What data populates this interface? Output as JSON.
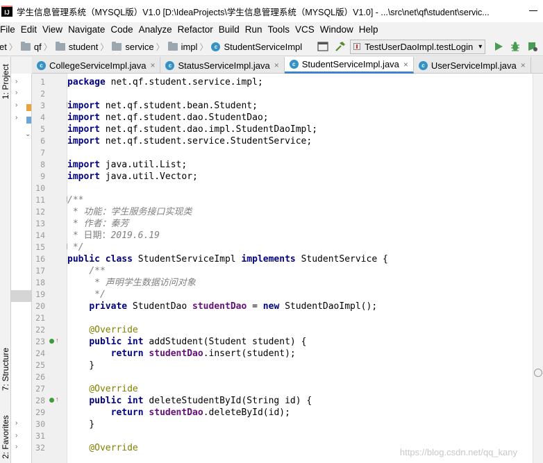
{
  "window": {
    "title": "学生信息管理系统（MYSQL版）V1.0 [D:\\IdeaProjects\\学生信息管理系统（MYSQL版）V1.0] - ...\\src\\net\\qf\\student\\servic..."
  },
  "menu": [
    "File",
    "Edit",
    "View",
    "Navigate",
    "Code",
    "Analyze",
    "Refactor",
    "Build",
    "Run",
    "Tools",
    "VCS",
    "Window",
    "Help"
  ],
  "breadcrumb": [
    "et",
    "qf",
    "student",
    "service",
    "impl",
    "StudentServiceImpl"
  ],
  "run_config": "TestUserDaoImpl.testLogin",
  "tabs": [
    {
      "label": "CollegeServiceImpl.java"
    },
    {
      "label": "StatusServiceImpl.java"
    },
    {
      "label": "StudentServiceImpl.java"
    },
    {
      "label": "UserServiceImpl.java"
    }
  ],
  "side_tabs": {
    "project": "1: Project",
    "structure": "7: Structure",
    "favorites": "2: Favorites"
  },
  "watermark": "https://blog.csdn.net/qq_kany",
  "code": {
    "line_numbers": [
      "1",
      "2",
      "3",
      "4",
      "5",
      "6",
      "7",
      "8",
      "9",
      "10",
      "11",
      "12",
      "13",
      "14",
      "15",
      "16",
      "17",
      "18",
      "19",
      "20",
      "21",
      "22",
      "23",
      "24",
      "25",
      "26",
      "27",
      "28",
      "29",
      "30",
      "31",
      "32"
    ],
    "l1": [
      "package",
      " net.qf.student.service.impl;"
    ],
    "l3": [
      "import",
      " net.qf.student.bean.Student;"
    ],
    "l4": [
      "import",
      " net.qf.student.dao.StudentDao;"
    ],
    "l5": [
      "import",
      " net.qf.student.dao.impl.StudentDaoImpl;"
    ],
    "l6": [
      "import",
      " net.qf.student.service.StudentService;"
    ],
    "l8": [
      "import",
      " java.util.List;"
    ],
    "l9": [
      "import",
      " java.util.Vector;"
    ],
    "l11": "/**",
    "l12": " * 功能：学生服务接口实现类",
    "l13": " * 作者：秦芳",
    "l14": [
      " * 日期：",
      "2019.6.19"
    ],
    "l15": " */",
    "l16": [
      "public class",
      " StudentServiceImpl ",
      "implements",
      " StudentService {"
    ],
    "l17": "    /**",
    "l18": "     * 声明学生数据访问对象",
    "l19": "     */",
    "l20": [
      "    ",
      "private",
      " StudentDao ",
      "studentDao",
      " = ",
      "new",
      " StudentDaoImpl();"
    ],
    "l22": "    @Override",
    "l23": [
      "    ",
      "public int",
      " addStudent(Student student) {"
    ],
    "l24": [
      "        ",
      "return",
      " ",
      "studentDao",
      ".insert(student);"
    ],
    "l25": "    }",
    "l27": "    @Override",
    "l28": [
      "    ",
      "public int",
      " deleteStudentById(String id) {"
    ],
    "l29": [
      "        ",
      "return",
      " ",
      "studentDao",
      ".deleteById(id);"
    ],
    "l30": "    }",
    "l32": "    @Override"
  }
}
